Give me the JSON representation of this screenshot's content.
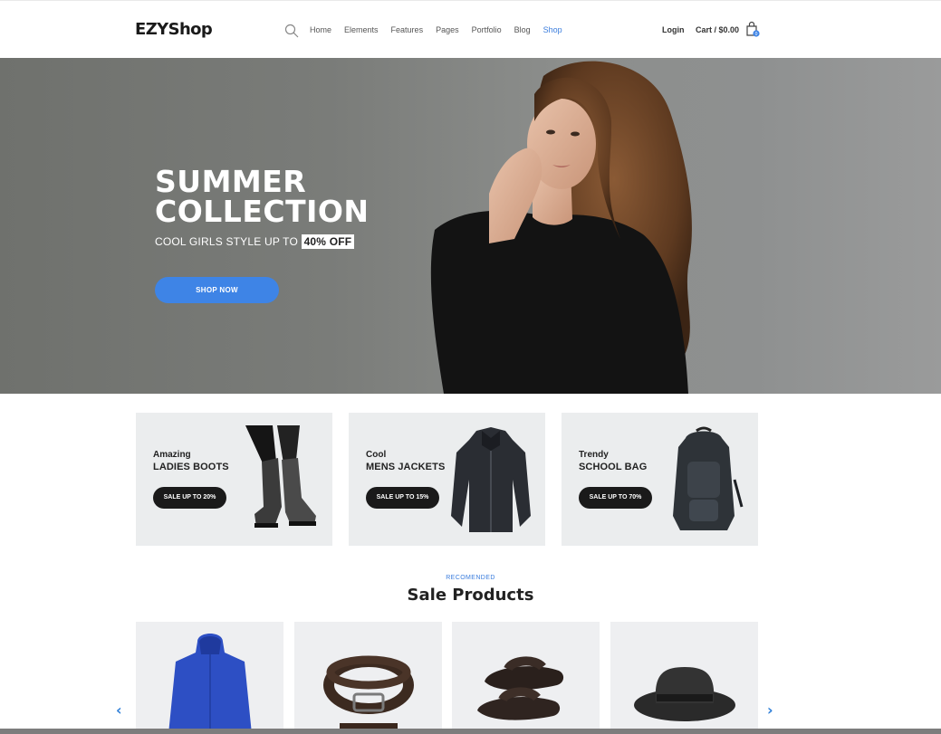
{
  "brand": {
    "logo": "EZYShop"
  },
  "nav": {
    "items": [
      "Home",
      "Elements",
      "Features",
      "Pages",
      "Portfolio",
      "Blog",
      "Shop"
    ],
    "active": "Shop",
    "login": "Login",
    "cart": "Cart / $0.00",
    "cart_count": "0"
  },
  "hero": {
    "title_line1": "SUMMER",
    "title_line2": "COLLECTION",
    "subtitle": "COOL GIRLS STYLE UP TO",
    "highlight": "40% OFF",
    "button": "SHOP NOW"
  },
  "promos": [
    {
      "kicker": "Amazing",
      "title": "LADIES BOOTS",
      "button": "SALE UP TO 20%",
      "icon": "boots-image"
    },
    {
      "kicker": "Cool",
      "title": "MENS JACKETS",
      "button": "SALE UP TO 15%",
      "icon": "jacket-image"
    },
    {
      "kicker": "Trendy",
      "title": "SCHOOL BAG",
      "button": "SALE UP TO 70%",
      "icon": "backpack-image"
    }
  ],
  "section": {
    "kicker": "RECOMENDED",
    "title": "Sale Products"
  },
  "products": [
    {
      "icon": "hoodie-image"
    },
    {
      "icon": "belt-image"
    },
    {
      "icon": "sandals-image"
    },
    {
      "icon": "hat-image"
    }
  ],
  "colors": {
    "accent": "#3e84e6",
    "dark": "#1a1a1a",
    "card_bg": "#ebedee"
  }
}
